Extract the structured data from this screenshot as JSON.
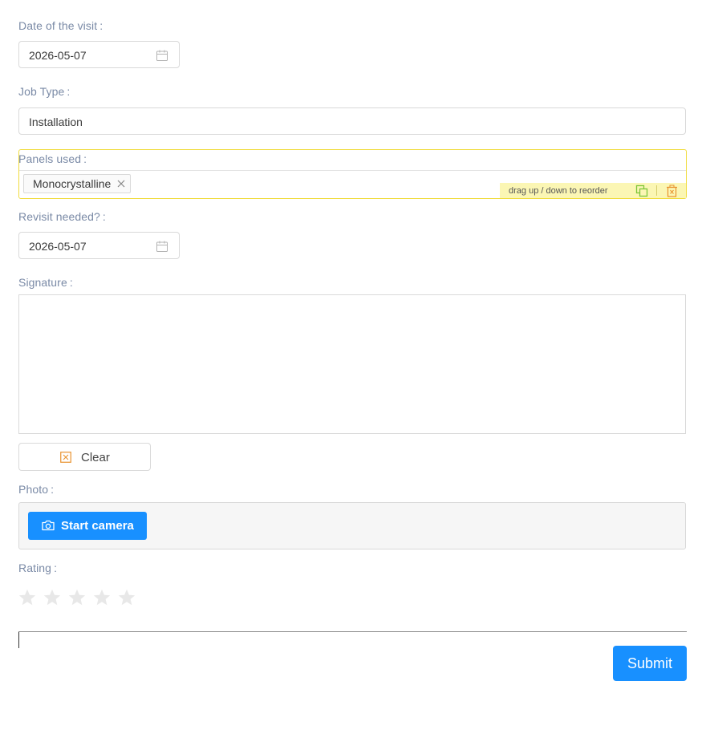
{
  "form": {
    "visit_date": {
      "label": "Date of the visit",
      "colon": ":",
      "value": "2026-05-07"
    },
    "job_type": {
      "label": "Job Type",
      "colon": ":",
      "value": "Installation"
    },
    "panels_used": {
      "label": "Panels used",
      "colon": ":",
      "tags": [
        "Monocrystalline"
      ],
      "reorder_hint": "drag up / down to reorder"
    },
    "revisit_needed": {
      "label": "Revisit needed?",
      "colon": ":",
      "value": "2026-05-07"
    },
    "signature": {
      "label": "Signature",
      "colon": ":",
      "clear_label": "Clear"
    },
    "photo": {
      "label": "Photo",
      "colon": ":",
      "start_camera_label": "Start camera"
    },
    "rating": {
      "label": "Rating",
      "colon": ":",
      "max": 5,
      "value": 0
    },
    "submit_label": "Submit"
  },
  "colors": {
    "label": "#7a8aa6",
    "primary": "#1890ff",
    "highlight_border": "#f0dc3c",
    "highlight_bg": "#fbf6b4",
    "star_empty": "#e8e8e8",
    "duplicate_icon": "#7ec63a",
    "delete_icon": "#e8922e"
  },
  "icons": {
    "calendar": "calendar-icon",
    "tag_close": "close-icon",
    "duplicate": "duplicate-icon",
    "delete": "trash-icon",
    "clear": "clear-icon",
    "camera": "camera-icon",
    "star": "star-icon"
  }
}
